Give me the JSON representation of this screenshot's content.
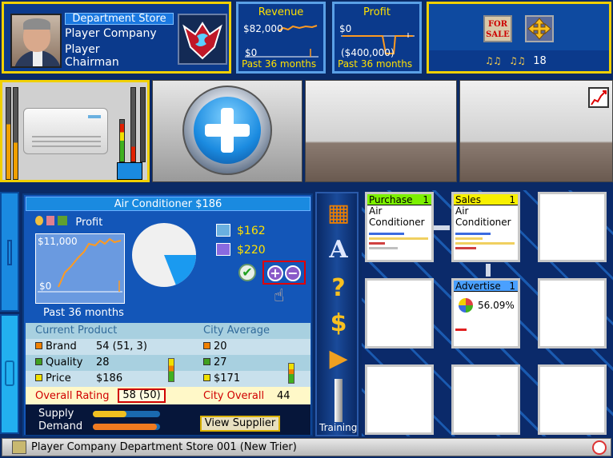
{
  "profile": {
    "store_type": "Department Store",
    "company": "Player Company",
    "name": "Player",
    "title": "Chairman"
  },
  "revenue": {
    "title": "Revenue",
    "max_label": "$82,000",
    "min_label": "$0",
    "footer": "Past 36 months"
  },
  "profit_top": {
    "title": "Profit",
    "max_label": "$0",
    "min_label": "($400,000)",
    "footer": "Past 36 months"
  },
  "tools": {
    "for_sale_label": "FOR SALE",
    "people_count": "18"
  },
  "detail": {
    "title": "Air Conditioner  $186",
    "profit_label": "Profit",
    "profit_max": "$11,000",
    "profit_min": "$0",
    "profit_footer": "Past 36 months",
    "cost_price": "$162",
    "sell_price": "$220",
    "pie_share_percent": 19
  },
  "table": {
    "current_header": "Current Product",
    "city_header": "City Average",
    "rows": [
      {
        "label": "Brand",
        "value": "54 (51, 3)",
        "city": "20",
        "color": "#f08000"
      },
      {
        "label": "Quality",
        "value": "28",
        "city": "27",
        "color": "#40a020"
      },
      {
        "label": "Price",
        "value": "$186",
        "city": "$171",
        "color": "#f0e000"
      }
    ],
    "overall_label": "Overall Rating",
    "overall_value": "58 (50)",
    "city_overall_label": "City Overall",
    "city_overall_value": "44"
  },
  "supply": {
    "supply_label": "Supply",
    "demand_label": "Demand",
    "supply_level": 0.5,
    "demand_level": 0.95,
    "view_supplier": "View Supplier"
  },
  "toolbar": {
    "training_label": "Training"
  },
  "grid": {
    "purchase": {
      "title": "Purchase",
      "num": "1",
      "line1": "Air",
      "line2": "Conditioner",
      "color": "#7cf000"
    },
    "sales": {
      "title": "Sales",
      "num": "1",
      "line1": "Air",
      "line2": "Conditioner",
      "color": "#f8f000"
    },
    "advertise": {
      "title": "Advertise",
      "num": "1",
      "percent": "56.09%",
      "color": "#4aa0ff"
    }
  },
  "status": {
    "text": "Player Company Department Store 001 (New Trier)"
  }
}
